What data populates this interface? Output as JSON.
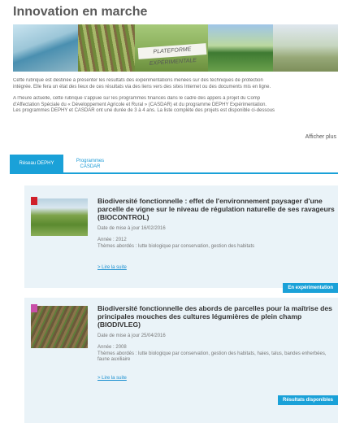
{
  "page": {
    "title": "Innovation en marche",
    "banner_sign": "PLATEFORME EXPÉRIMENTALE",
    "intro_lines": [
      "Cette rubrique est destinée à présenter les résultats des expérimentations menées sur des techniques de protection",
      "intégrée. Elle fera un état des lieux de ces résultats via des liens vers des sites Internet ou des documents mis en ligne.",
      "A l'heure actuelle, cette rubrique s'appuie sur les programmes financés dans le cadre des appels à projet du Comp",
      "d'Affectation Spéciale du « Développement Agricole et Rural » (CASDAR) et du programme DEPHY Expérimentation.",
      "Les programmes DEPHY et CASDAR ont une durée de 3 à 4 ans. La liste complète des projets est disponible ci-dessous"
    ],
    "show_more": "Afficher plus"
  },
  "tabs": [
    {
      "label": "Réseau DEPHY"
    },
    {
      "label": "Programmes CASDAR"
    }
  ],
  "cards": [
    {
      "title": "Biodiversité fonctionnelle : effet de l'environnement paysager d'une parcelle de vigne sur le niveau de régulation naturelle de ses ravageurs (BIOCONTROL)",
      "date": "Date de mise à jour 16/02/2016",
      "year": "Année : 2012",
      "themes": "Thèmes abordés : lutte biologique par conservation, gestion des habitats",
      "readmore": "> Lire la suite",
      "status": "En expérimentation",
      "colors": {
        "tag": "#d0202a"
      }
    },
    {
      "title": "Biodiversité fonctionnelle des abords de parcelles pour la maîtrise des principales mouches des cultures légumières de plein champ (BIODIVLEG)",
      "date": "Date de mise à jour 25/04/2016",
      "year": "Année : 2008",
      "themes": "Thèmes abordés : lutte biologique par conservation, gestion des habitats, haies, talus, bandes enherbées, faune auxiliaire",
      "readmore": "> Lire la suite",
      "status": "Résultats disponibles",
      "colors": {
        "tag": "#c84fa8"
      }
    }
  ],
  "colors": {
    "accent": "#1aa1d8",
    "card_bg": "#eaf3f8",
    "title": "#5a5a5a"
  }
}
